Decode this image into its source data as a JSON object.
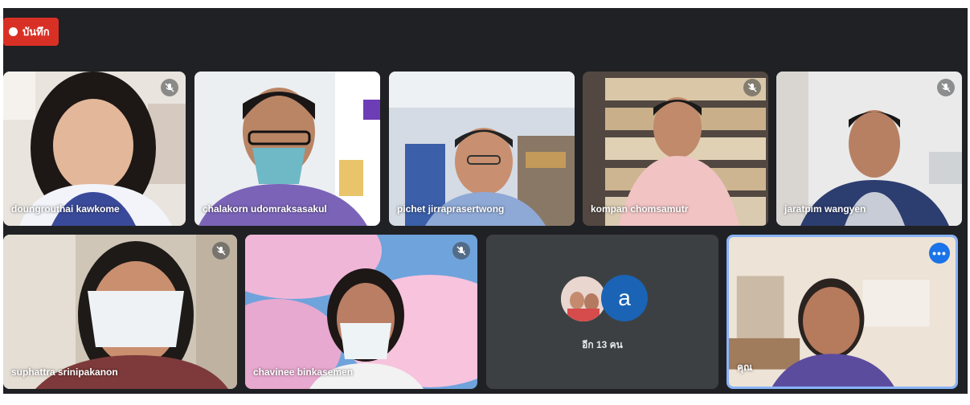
{
  "recording": {
    "label": "บันทึก",
    "color": "#d93025"
  },
  "participants": [
    {
      "name": "doungrouthai kawkome",
      "muted": true
    },
    {
      "name": "chalakorn udomraksasakul",
      "muted": false
    },
    {
      "name": "pichet jirraprasertwong",
      "muted": false
    },
    {
      "name": "kompan chomsamutr",
      "muted": true
    },
    {
      "name": "jaratpim wangyen",
      "muted": true
    },
    {
      "name": "suphattra srinipakanon",
      "muted": true
    },
    {
      "name": "chavinee binkasemen",
      "muted": true
    }
  ],
  "overflow": {
    "avatar_letter": "a",
    "label": "อีก 13 คน"
  },
  "self": {
    "name": "คุณ",
    "more_options_icon": "more-horizontal-icon"
  },
  "colors": {
    "background": "#202124",
    "tile": "#3c4043",
    "self_border": "#8ab4f8",
    "avatar_blue": "#1a63b5"
  }
}
